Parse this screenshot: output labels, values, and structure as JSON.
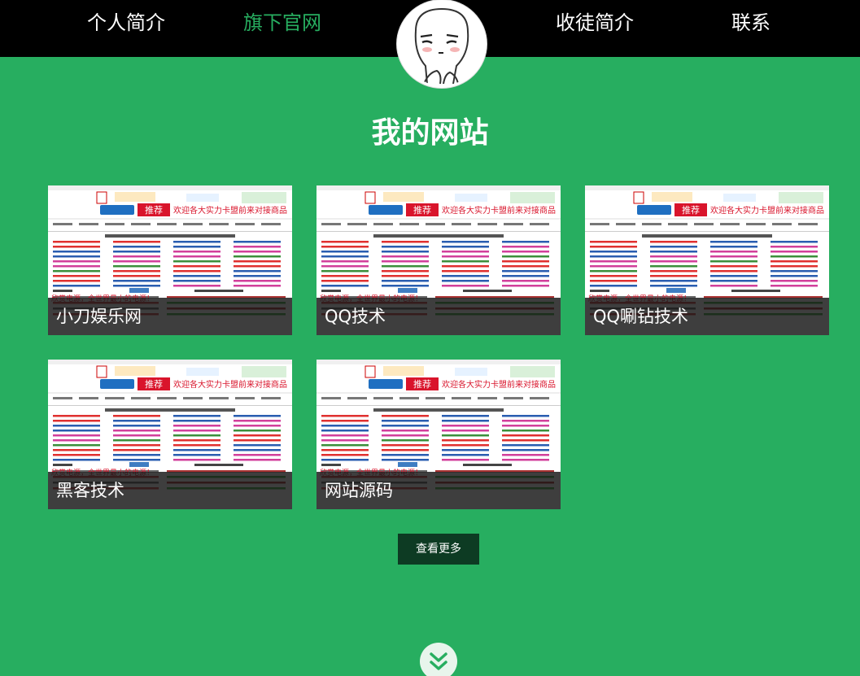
{
  "nav": {
    "items": [
      {
        "label": "个人简介",
        "active": false
      },
      {
        "label": "旗下官网",
        "active": true
      },
      {
        "label": "收徒简介",
        "active": false
      },
      {
        "label": "联系",
        "active": false
      }
    ]
  },
  "section": {
    "title": "我的网站"
  },
  "sites": [
    {
      "label": "小刀娱乐网"
    },
    {
      "label": "QQ技术"
    },
    {
      "label": "QQ唰钻技术"
    },
    {
      "label": "黑客技术"
    },
    {
      "label": "网站源码"
    }
  ],
  "thumb": {
    "banner_text": "欢迎各大实力卡盟前来对接商品",
    "badge_text": "推荐",
    "row_text": "每天赚一下",
    "promo_text": "欣赏电源，全世界最小的电源！"
  },
  "more_button": {
    "label": "查看更多"
  },
  "colors": {
    "accent": "#27ae60",
    "topbar": "#000000",
    "button": "#0d3b23"
  },
  "icons": {
    "scroll_down": "double-chevron-down-icon"
  }
}
